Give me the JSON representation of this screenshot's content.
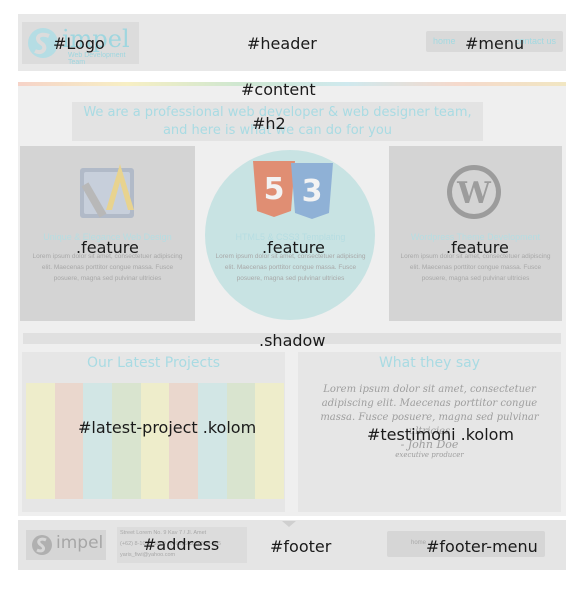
{
  "region_labels": {
    "logo": "#Logo",
    "header": "#header",
    "menu": "#menu",
    "content": "#content",
    "h2": "#h2",
    "feature": ".feature",
    "shadow": ".shadow",
    "latest_project": "#latest-project .kolom",
    "testimoni": "#testimoni .kolom",
    "address": "#address",
    "footer": "#footer",
    "footer_menu": "#footer-menu"
  },
  "header": {
    "logo_word": "impel",
    "logo_tagline": "Web Development Team",
    "menu_items": [
      "home",
      "contact us"
    ]
  },
  "content": {
    "h2_line1": "We are a professional web developer & web designer team,",
    "h2_line2": "and here is what we can do for you",
    "features": [
      {
        "title": "Unique & Elegance Web Design",
        "body": "Lorem ipsum dolor sit amet, consectetuer adipiscing elit. Maecenas porttitor congue massa. Fusce posuere, magna sed pulvinar ultricies",
        "icon": "design-app-icon"
      },
      {
        "title": "HTML5 & CSS3 Templating",
        "body": "Lorem ipsum dolor sit amet, consectetuer adipiscing elit. Maecenas porttitor congue massa. Fusce posuere, magna sed pulvinar ultricies",
        "icon": "html5-css3-icon"
      },
      {
        "title": "Wordpress Theme Development",
        "body": "Lorem ipsum dolor sit amet, consectetuer adipiscing elit. Maecenas porttitor congue massa. Fusce posuere, magna sed pulvinar ultricies",
        "icon": "wordpress-icon"
      }
    ],
    "latest_heading": "Our Latest Projects",
    "latest_stripe_colors": [
      "#eeedcb",
      "#ead7cd",
      "#d2e6e5",
      "#d9e4cf",
      "#eeedcb",
      "#ead7cd",
      "#d2e6e5",
      "#d9e4cf",
      "#eeedcb"
    ],
    "testimoni_heading": "What they say",
    "quote": "Lorem ipsum dolor sit amet, consectetuer adipiscing elit. Maecenas porttitor congue massa. Fusce posuere, magna sed pulvinar ultricies",
    "quote_name": "- John Doe",
    "quote_role": "executive producer"
  },
  "footer": {
    "logo_word": "impel",
    "address_lines": [
      "Street Lorem No. 9 Kav 7 / Jl. Amet",
      "(+62) 8-1000-1000 / (+62) 9-555-555-865",
      "yaris_fiwi@yahoo.com"
    ],
    "menu_item": "home"
  },
  "colors": {
    "accent": "#a9dbe3",
    "panel": "#d4d4d4",
    "background": "#efefef"
  }
}
